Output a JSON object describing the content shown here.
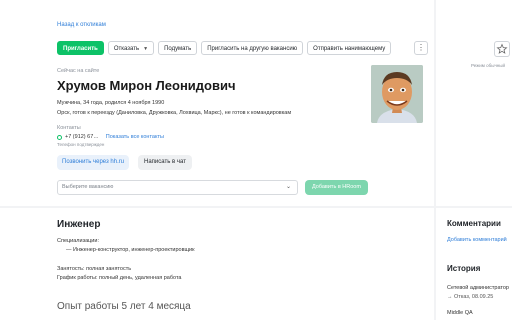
{
  "header": {
    "back_link": "Назад к откликам"
  },
  "toolbar": {
    "invite": "Пригласить",
    "reject": "Отказать",
    "think": "Подумать",
    "invite_other": "Пригласить на другую вакансию",
    "send_to_manager": "Отправить нанимающему",
    "more": "⋮"
  },
  "candidate": {
    "status": "Сейчас на сайте",
    "name": "Хрумов Мирон Леонидович",
    "info_line1": "Мужчина, 34 года, родился 4 ноября 1990",
    "info_line2": "Орск, готов к переезду (Даниловка, Дружковка, Лохвица, Маркс), не готов к командировкам",
    "contacts_label": "Контакты",
    "phone": "+7 (912) 67…",
    "show_contacts": "Показать все контакты",
    "phone_confirmed": "Телефон подтвержден",
    "call_button": "Позвонить через hh.ru",
    "chat_button": "Написать в чат"
  },
  "vacancy_select": {
    "placeholder": "Выберите вакансию",
    "add_button": "Добавить в HRoom"
  },
  "sidebar": {
    "view_mode": "Режим обычный"
  },
  "resume": {
    "title": "Инженер",
    "spec_label": "Специализации:",
    "spec_item": "— Инженер-конструктор, инженер-проектировщик",
    "employment": "Занятость: полная занятость",
    "schedule": "График работы: полный день, удаленная работа",
    "experience": "Опыт работы 5 лет 4 месяца"
  },
  "comments": {
    "title": "Комментарии",
    "add": "Добавить комментарий"
  },
  "history": {
    "title": "История",
    "line1": "Сетевой администратор",
    "line2": "→ Отказ, 08.09.25",
    "line3": "Middle QA"
  },
  "colors": {
    "accent_green": "#0dc267",
    "link_blue": "#2f7ed8",
    "hroom_green": "#7dd6ae"
  },
  "icons": {
    "chevron": "chevron-down-icon",
    "star": "star-icon",
    "more": "more-vertical-icon",
    "phone_status": "circle-check-icon"
  }
}
